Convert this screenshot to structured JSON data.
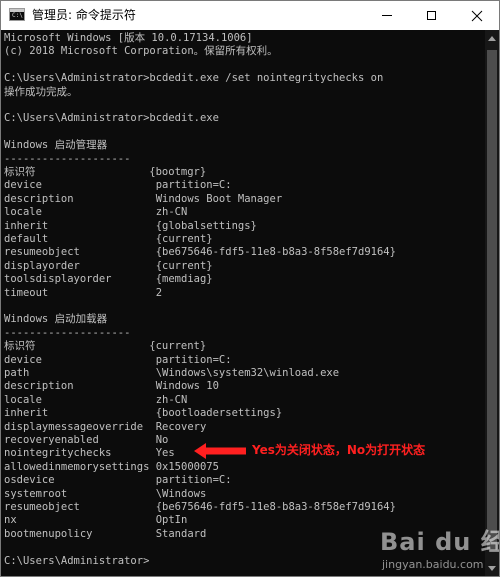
{
  "window": {
    "title": "管理员: 命令提示符",
    "icon": "cmd-icon",
    "controls": [
      "minimize-icon",
      "maximize-icon",
      "close-icon"
    ]
  },
  "console": {
    "lines": [
      "Microsoft Windows [版本 10.0.17134.1006]",
      "(c) 2018 Microsoft Corporation。保留所有权利。",
      "",
      "C:\\Users\\Administrator>bcdedit.exe /set nointegritychecks on",
      "操作成功完成。",
      "",
      "C:\\Users\\Administrator>bcdedit.exe",
      "",
      "Windows 启动管理器",
      "--------------------",
      "标识符                  {bootmgr}",
      "device                  partition=C:",
      "description             Windows Boot Manager",
      "locale                  zh-CN",
      "inherit                 {globalsettings}",
      "default                 {current}",
      "resumeobject            {be675646-fdf5-11e8-b8a3-8f58ef7d9164}",
      "displayorder            {current}",
      "toolsdisplayorder       {memdiag}",
      "timeout                 2",
      "",
      "Windows 启动加载器",
      "--------------------",
      "标识符                  {current}",
      "device                  partition=C:",
      "path                    \\Windows\\system32\\winload.exe",
      "description             Windows 10",
      "locale                  zh-CN",
      "inherit                 {bootloadersettings}",
      "displaymessageoverride  Recovery",
      "recoveryenabled         No",
      "nointegritychecks       Yes",
      "allowedinmemorysettings 0x15000075",
      "osdevice                partition=C:",
      "systemroot              \\Windows",
      "resumeobject            {be675646-fdf5-11e8-b8a3-8f58ef7d9164}",
      "nx                      OptIn",
      "bootmenupolicy          Standard",
      "",
      "C:\\Users\\Administrator>"
    ]
  },
  "annotation": {
    "text": "Yes为关闭状态，No为打开状态",
    "color": "#ff2020"
  },
  "watermark": {
    "logo": "Bai du 经验",
    "url": "jingyan.baidu.com"
  },
  "colors": {
    "console_bg": "#0c0c0c",
    "console_text": "#c0c0c0",
    "titlebar_bg": "#ffffff"
  }
}
